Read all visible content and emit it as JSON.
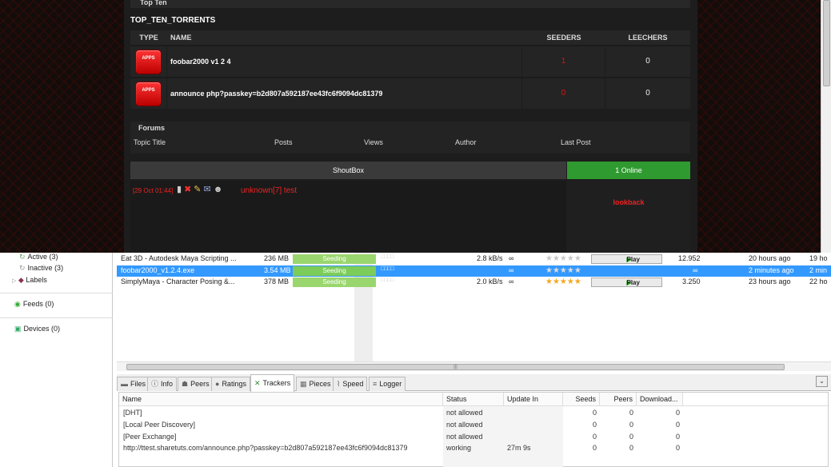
{
  "web": {
    "top_ten_label": "Top Ten",
    "top_ten_title": "TOP_TEN_TORRENTS",
    "headers": {
      "type": "TYPE",
      "name": "NAME",
      "seeders": "SEEDERS",
      "leechers": "LEECHERS"
    },
    "rows": [
      {
        "badge": "APPS",
        "name": "foobar2000 v1 2 4",
        "seeders": "1",
        "leechers": "0"
      },
      {
        "badge": "APPS",
        "name": "announce php?passkey=b2d807a592187ee43fc6f9094dc81379",
        "seeders": "0",
        "leechers": "0"
      }
    ],
    "forums": {
      "title": "Forums",
      "headers": [
        "Topic Title",
        "Posts",
        "Views",
        "Author",
        "Last Post"
      ]
    },
    "shoutbox": {
      "label": "ShoutBox",
      "online": "1 Online",
      "time": "[29 Oct 01:44]",
      "message": "unknown[7] test",
      "lookback": "lookback"
    }
  },
  "sidebar": {
    "active": "Active (3)",
    "inactive": "Inactive (3)",
    "labels": "Labels",
    "feeds": "Feeds (0)",
    "devices": "Devices (0)"
  },
  "torrents": [
    {
      "name": "Eat 3D - Autodesk Maya Scripting ...",
      "size": "236 MB",
      "status": "Seeding",
      "down": "2.8 kB/s",
      "eta": "∞",
      "rating": 0,
      "play": "Play",
      "ratio": "12.952",
      "added": "20 hours ago",
      "extra": "19 ho"
    },
    {
      "name": "foobar2000_v1.2.4.exe",
      "size": "3.54 MB",
      "status": "Seeding",
      "down": "",
      "eta": "∞",
      "rating": 0,
      "play": "",
      "ratio": "∞",
      "added": "2 minutes ago",
      "extra": "2 min"
    },
    {
      "name": "SimplyMaya - Character Posing &...",
      "size": "378 MB",
      "status": "Seeding",
      "down": "2.0 kB/s",
      "eta": "∞",
      "rating": 5,
      "play": "Play",
      "ratio": "3.250",
      "added": "23 hours ago",
      "extra": "22 ho"
    }
  ],
  "tabs": [
    "Files",
    "Info",
    "Peers",
    "Ratings",
    "Trackers",
    "Pieces",
    "Speed",
    "Logger"
  ],
  "active_tab": "Trackers",
  "tracker_headers": {
    "name": "Name",
    "status": "Status",
    "update": "Update In",
    "seeds": "Seeds",
    "peers": "Peers",
    "downloaded": "Download..."
  },
  "trackers": [
    {
      "name": "[DHT]",
      "status": "not allowed",
      "update": "",
      "seeds": "0",
      "peers": "0",
      "downloaded": "0"
    },
    {
      "name": "[Local Peer Discovery]",
      "status": "not allowed",
      "update": "",
      "seeds": "0",
      "peers": "0",
      "downloaded": "0"
    },
    {
      "name": "[Peer Exchange]",
      "status": "not allowed",
      "update": "",
      "seeds": "0",
      "peers": "0",
      "downloaded": "0"
    },
    {
      "name": "http://ttest.sharetuts.com/announce.php?passkey=b2d807a592187ee43fc6f9094dc81379",
      "status": "working",
      "update": "27m 9s",
      "seeds": "0",
      "peers": "0",
      "downloaded": "0"
    }
  ]
}
